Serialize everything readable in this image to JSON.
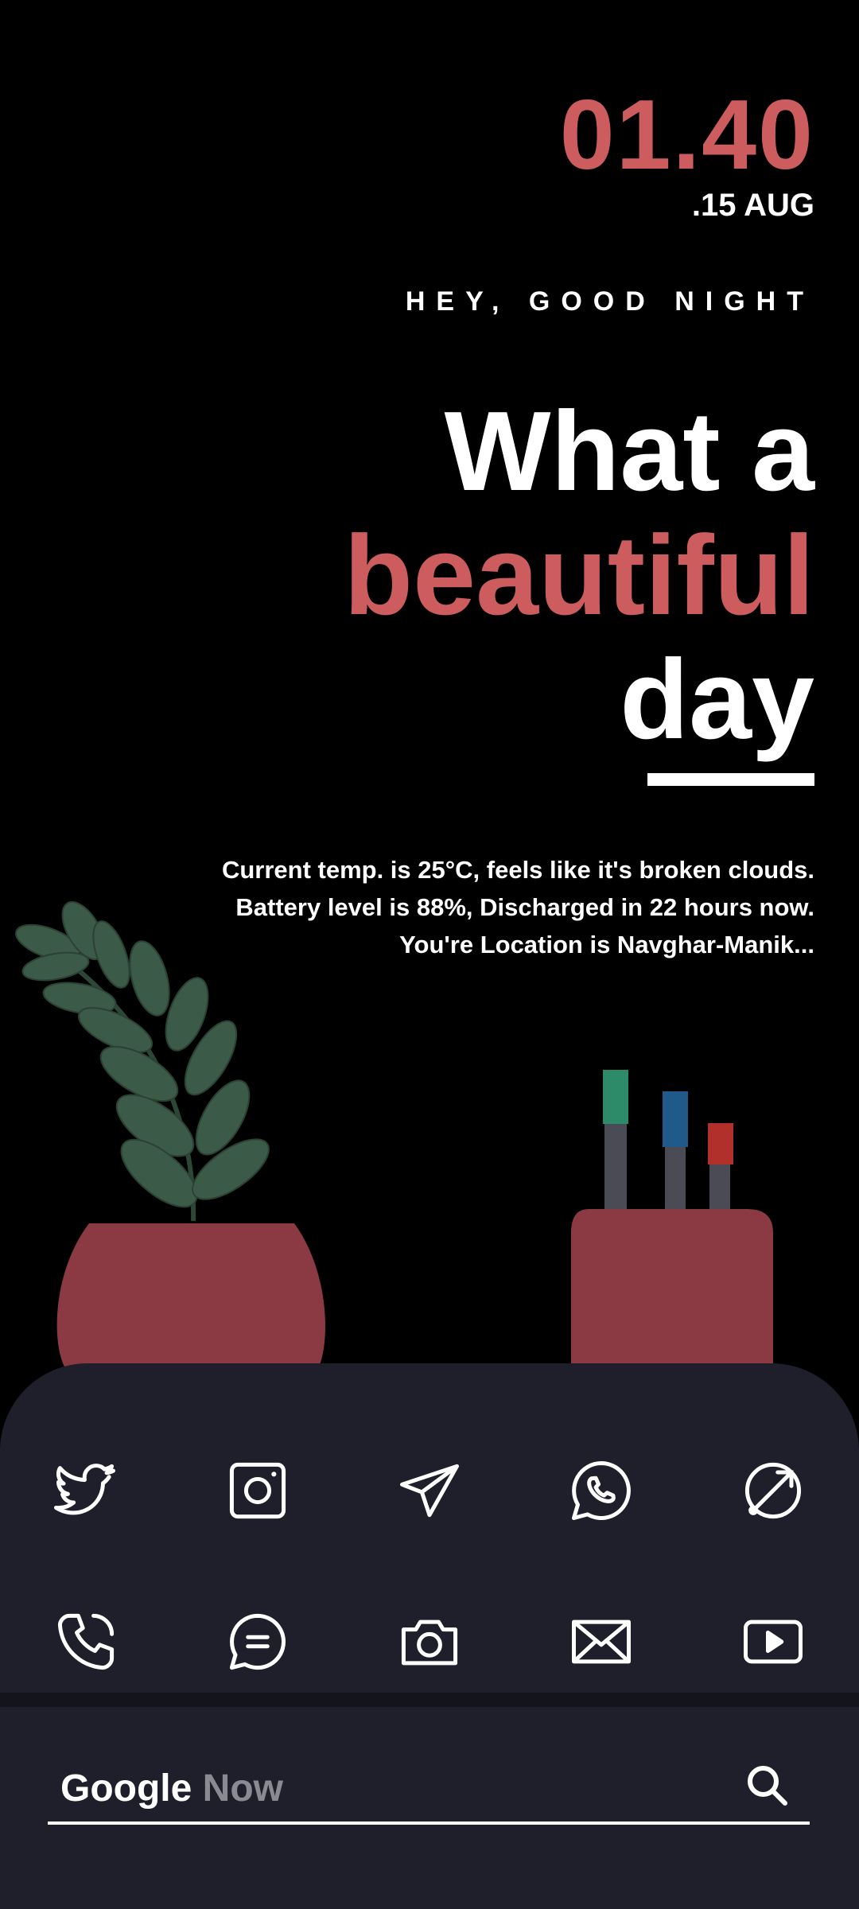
{
  "theme": {
    "accent": "#cd5c5f",
    "background": "#000000",
    "dock_bg": "#1e1f2b",
    "pot_color": "#8b3a43",
    "leaf_color": "#3c5a48"
  },
  "clock": {
    "time": "01.40",
    "date": ".15 AUG"
  },
  "greeting": "HEY, GOOD NIGHT",
  "headline": {
    "line1": "What a",
    "line2": "beautiful",
    "line3": "day"
  },
  "info": {
    "weather": "Current temp. is 25°C, feels like it's broken clouds.",
    "battery": "Battery level is 88%, Discharged in 22 hours now.",
    "location": "You're Location is Navghar-Manik..."
  },
  "dock": {
    "row1": [
      {
        "icon": "twitter-icon"
      },
      {
        "icon": "instagram-icon"
      },
      {
        "icon": "telegram-icon"
      },
      {
        "icon": "whatsapp-icon"
      },
      {
        "icon": "browser-icon"
      }
    ],
    "row2": [
      {
        "icon": "phone-icon"
      },
      {
        "icon": "messages-icon"
      },
      {
        "icon": "camera-icon"
      },
      {
        "icon": "mail-icon"
      },
      {
        "icon": "youtube-icon"
      }
    ]
  },
  "search": {
    "brand_google": "Google",
    "brand_now": "Now",
    "icon": "search-icon"
  }
}
